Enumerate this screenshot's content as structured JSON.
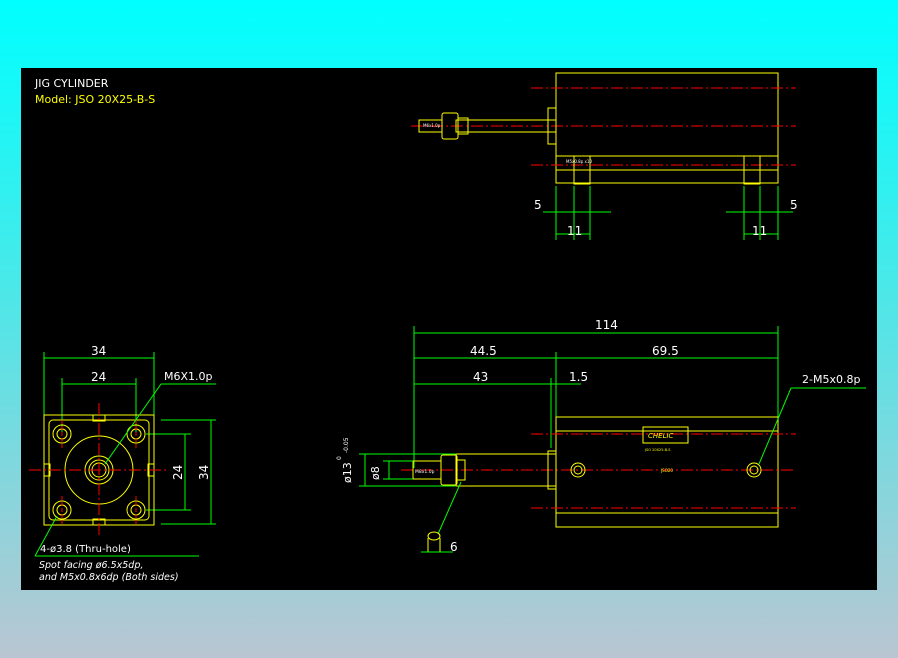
{
  "header": {
    "title": "JIG CYLINDER",
    "model": "Model: JSO 20X25-B-S"
  },
  "colors": {
    "background_top": "#00ffff",
    "background_bottom": "#b9c6d2",
    "canvas": "#000000",
    "outline": "#ffff00",
    "dimension": "#00ff00",
    "centerline": "#ff0000",
    "text": "#ffffff"
  },
  "top_view": {
    "dim_left_gap": "5",
    "dim_left_width": "11",
    "dim_right_gap": "5",
    "dim_right_width": "11"
  },
  "front_view": {
    "dim_total": "114",
    "dim_front": "44.5",
    "dim_body": "69.5",
    "dim_rod": "43",
    "dim_flange": "1.5",
    "port_callout": "2-M5x0.8p",
    "rod_dia": "ø13",
    "rod_tol_upper": "0",
    "rod_tol_lower": "-0.05",
    "piston_dia": "ø8",
    "nut_width": "6"
  },
  "end_view": {
    "dim_width": "34",
    "dim_bolt_pitch": "24",
    "dim_bolt_pitch_v": "24",
    "dim_height": "34",
    "thread_callout": "M6X1.0p",
    "hole_callout": "4-ø3.8 (Thru-hole)",
    "note_line1": "Spot facing ø6.5x5dp,",
    "note_line2": "and M5x0.8x6dp (Both sides)"
  }
}
